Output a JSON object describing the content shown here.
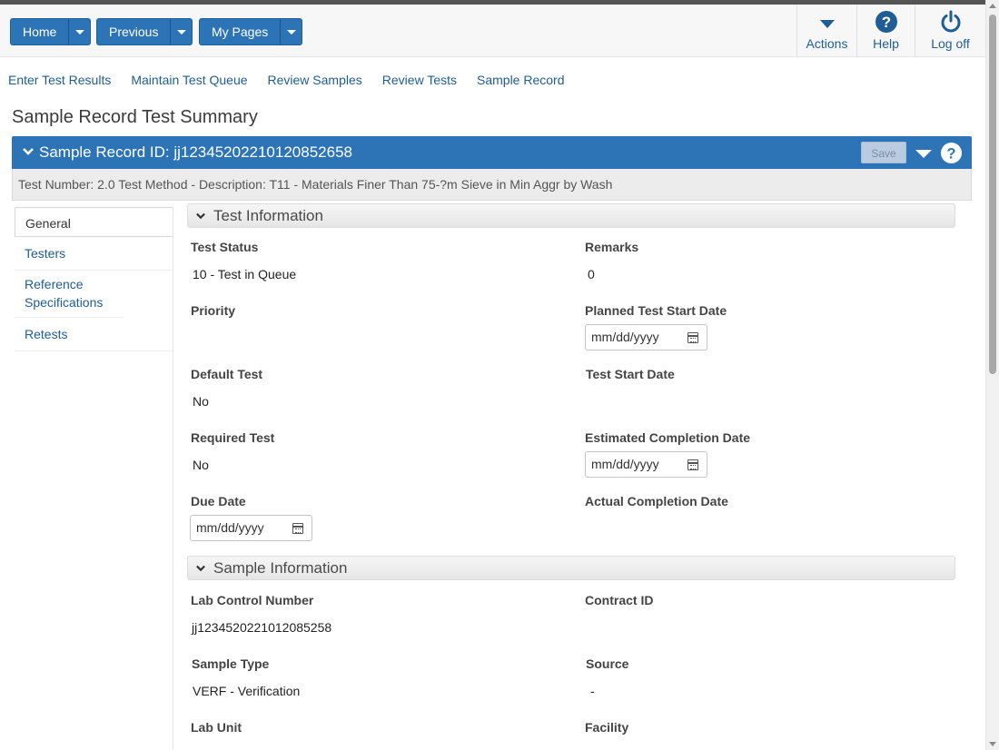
{
  "header": {
    "home_label": "Home",
    "previous_label": "Previous",
    "mypages_label": "My Pages",
    "actions_label": "Actions",
    "help_label": "Help",
    "logoff_label": "Log off"
  },
  "nav_links": [
    "Enter Test Results",
    "Maintain Test Queue",
    "Review Samples",
    "Review Tests",
    "Sample Record"
  ],
  "page_title": "Sample Record Test Summary",
  "record": {
    "title": "Sample Record ID: jj1234520221012085265​8",
    "save_label": "Save",
    "test_description": "Test Number: 2.0 Test Method - Description: T11 - Materials Finer Than 75-?m Sieve in Min Aggr by Wash"
  },
  "side_menu": [
    "General",
    "Testers",
    "Reference Specifications",
    "Retests"
  ],
  "test_information": {
    "heading": "Test Information",
    "test_status_label": "Test Status",
    "test_status_value": "10 - Test in Queue",
    "remarks_label": "Remarks",
    "remarks_value": "0",
    "priority_label": "Priority",
    "planned_start_label": "Planned Test Start Date",
    "planned_start_placeholder": "mm/dd/yyyy",
    "default_test_label": "Default Test",
    "default_test_value": "No",
    "test_start_label": "Test Start Date",
    "required_test_label": "Required Test",
    "required_test_value": "No",
    "estimated_completion_label": "Estimated Completion Date",
    "estimated_completion_placeholder": "mm/dd/yyyy",
    "due_date_label": "Due Date",
    "due_date_placeholder": "mm/dd/yyyy",
    "actual_completion_label": "Actual Completion Date"
  },
  "sample_information": {
    "heading": "Sample Information",
    "lab_control_label": "Lab Control Number",
    "lab_control_value": "jj12345202210120852​58",
    "contract_id_label": "Contract ID",
    "sample_type_label": "Sample Type",
    "sample_type_value": "VERF - Verification",
    "source_label": "Source",
    "source_value": "-",
    "lab_unit_label": "Lab Unit",
    "facility_label": "Facility"
  },
  "colors": {
    "primary": "#2d74b6",
    "link": "#1f5d94"
  }
}
